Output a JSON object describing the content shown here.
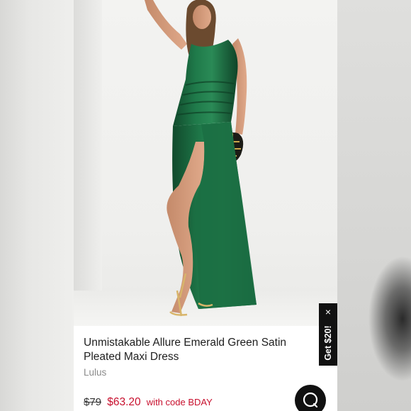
{
  "product": {
    "title": "Unmistakable Allure Emerald Green Satin Pleated Maxi Dress",
    "brand": "Lulus",
    "original_price": "$79",
    "sale_price": "$63.20",
    "promo_text": "with code BDAY"
  },
  "promo_tab": {
    "label": "Get $20!",
    "close_glyph": "×"
  },
  "icons": {
    "chat": "chat-bubble-icon",
    "close": "close-icon"
  },
  "colors": {
    "dress": "#1f6b43",
    "sale": "#c8102e",
    "tab_bg": "#111111"
  }
}
